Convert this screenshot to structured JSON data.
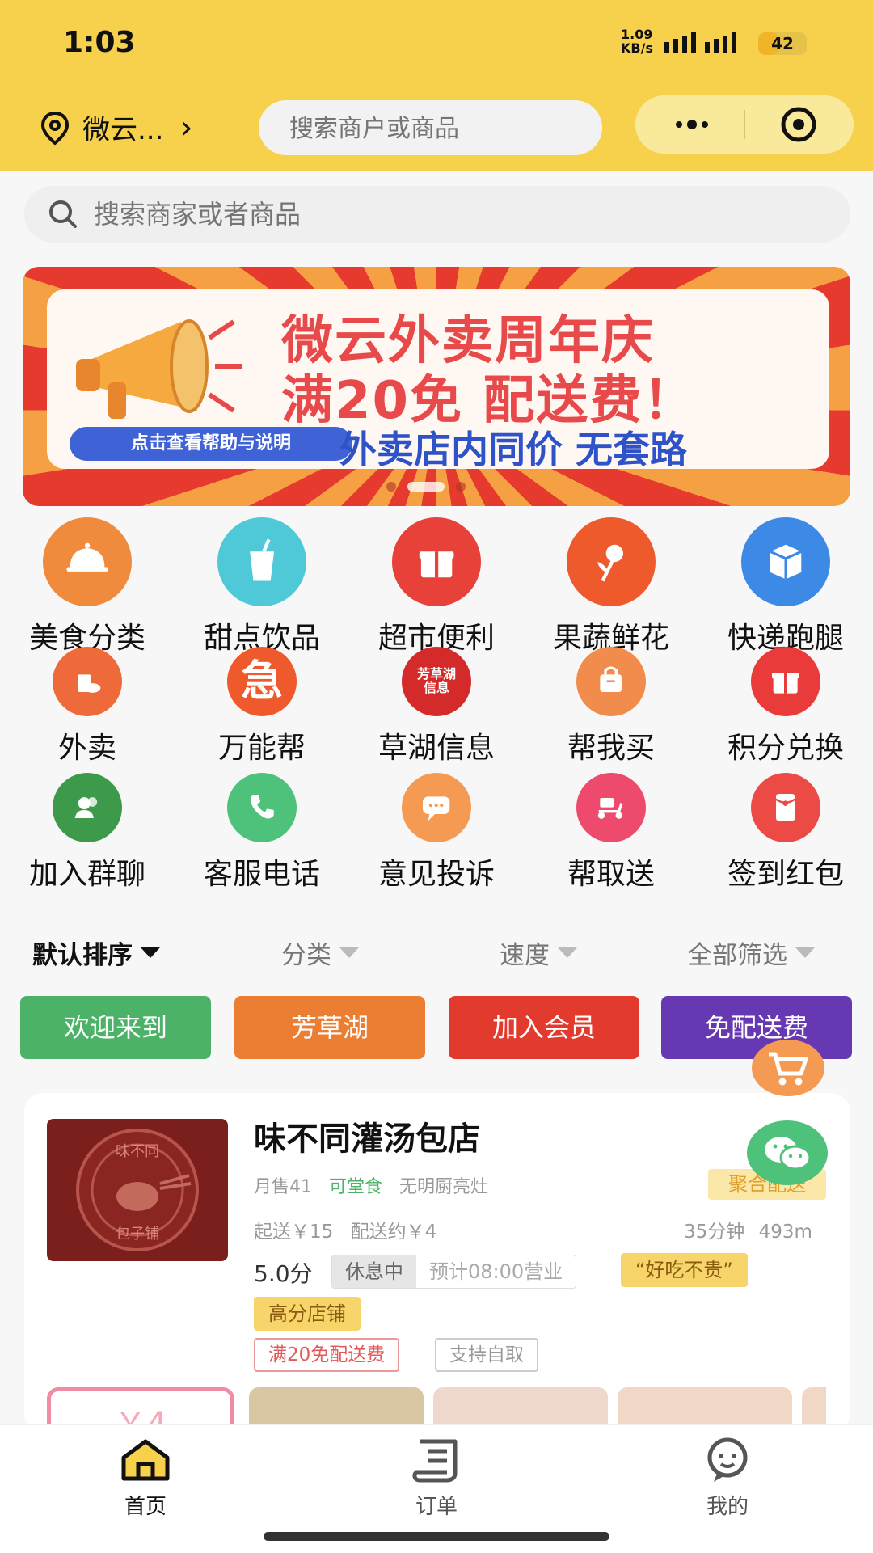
{
  "status_bar": {
    "time": "1:03",
    "net_speed_value": "1.09",
    "net_speed_unit": "KB/s",
    "battery": "42"
  },
  "header": {
    "location": "微云...",
    "search_placeholder": "搜索商户或商品"
  },
  "main_search": {
    "placeholder": "搜索商家或者商品"
  },
  "banner": {
    "line1": "微云外卖周年庆",
    "line2": "满20免 配送费！",
    "help_pill": "点击查看帮助与说明",
    "line3": "外卖店内同价 无套路",
    "active_dot": 1
  },
  "categories": [
    {
      "label": "美食分类",
      "icon": "cloche-icon",
      "color": "#f08a3c"
    },
    {
      "label": "甜点饮品",
      "icon": "cup-icon",
      "color": "#4fc9d8"
    },
    {
      "label": "超市便利",
      "icon": "gift-box-icon",
      "color": "#e8413a"
    },
    {
      "label": "果蔬鲜花",
      "icon": "rose-icon",
      "color": "#ef5a2c"
    },
    {
      "label": "快递跑腿",
      "icon": "package-icon",
      "color": "#3d8ae6"
    },
    {
      "label": "外卖",
      "icon": "takeaway-icon",
      "color": "#ef6a3a"
    },
    {
      "label": "万能帮",
      "icon": "urgent-icon",
      "color": "#ef5a2c",
      "glyph": "急"
    },
    {
      "label": "草湖信息",
      "icon": "info-icon",
      "color": "#d42a2a",
      "glyph": "芳草湖信息"
    },
    {
      "label": "帮我买",
      "icon": "shopping-bag-icon",
      "color": "#f28c4c"
    },
    {
      "label": "积分兑换",
      "icon": "points-gift-icon",
      "color": "#ea3b3b"
    },
    {
      "label": "加入群聊",
      "icon": "group-icon",
      "color": "#3d9a4a"
    },
    {
      "label": "客服电话",
      "icon": "phone-icon",
      "color": "#4ec27a"
    },
    {
      "label": "意见投诉",
      "icon": "chat-bubble-icon",
      "color": "#f59a52"
    },
    {
      "label": "帮取送",
      "icon": "scooter-icon",
      "color": "#ee4a6e"
    },
    {
      "label": "签到红包",
      "icon": "red-envelope-icon",
      "color": "#ec4a44"
    }
  ],
  "sort_bar": {
    "items": [
      "默认排序",
      "分类",
      "速度",
      "全部筛选"
    ],
    "active": 0
  },
  "promo_tags": [
    {
      "label": "欢迎来到",
      "color": "#4cb267"
    },
    {
      "label": "芳草湖",
      "color": "#ec7e34"
    },
    {
      "label": "加入会员",
      "color": "#e23b2e"
    },
    {
      "label": "免配送费",
      "color": "#6638b2"
    }
  ],
  "shop": {
    "name": "味不同灌汤包店",
    "logo_text_top": "味不同",
    "logo_text_bottom": "包子铺",
    "monthly_sales": "月售41",
    "dine_in": "可堂食",
    "kitchen": "无明厨亮灶",
    "delivery_badge": "聚合配送",
    "min_order": "起送￥15",
    "delivery_fee": "配送约￥4",
    "time": "35分钟",
    "distance": "493m",
    "rating": "5.0分",
    "status": "休息中",
    "opening": "预计08:00营业",
    "review_tag": "“好吃不贵”",
    "high_score_tag": "高分店铺",
    "promo_free_delivery": "满20免配送费",
    "promo_pickup": "支持自取",
    "coupon_value": "￥4"
  },
  "bottom_nav": [
    {
      "label": "首页",
      "icon": "home-icon",
      "active": true
    },
    {
      "label": "订单",
      "icon": "order-icon",
      "active": false
    },
    {
      "label": "我的",
      "icon": "profile-icon",
      "active": false
    }
  ],
  "colors": {
    "brand_yellow": "#f7d14c",
    "accent_green": "#4cb267",
    "text_gray": "#999999"
  }
}
